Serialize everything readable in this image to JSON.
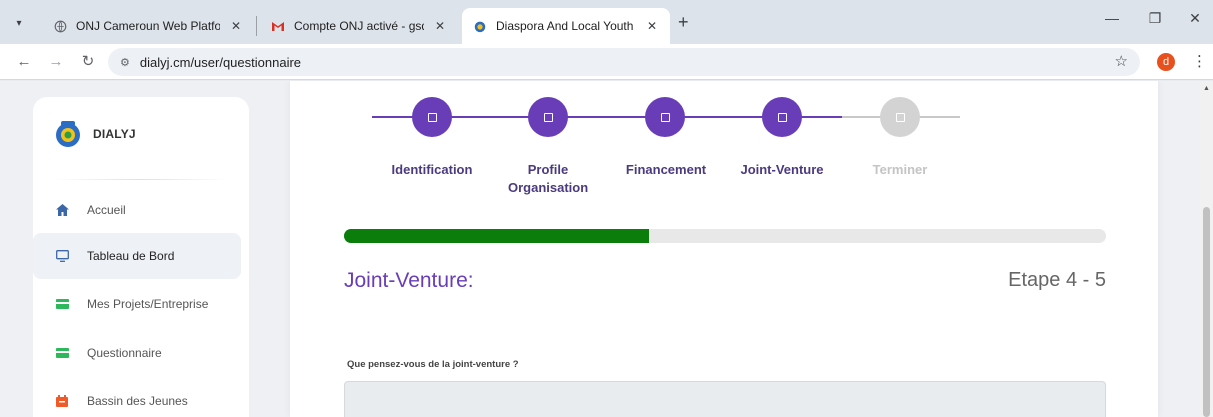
{
  "browser": {
    "tabs": [
      {
        "title": "ONJ Cameroun Web Platform",
        "active": false
      },
      {
        "title": "Compte ONJ activé - gsddialyj@",
        "active": false
      },
      {
        "title": "Diaspora And Local Youth Joint",
        "active": true
      }
    ],
    "url": "dialyj.cm/user/questionnaire",
    "profile_initial": "d"
  },
  "sidebar": {
    "brand": "DIALYJ",
    "items": [
      {
        "label": "Accueil",
        "icon": "home-icon"
      },
      {
        "label": "Tableau de Bord",
        "icon": "monitor-icon",
        "active": true
      },
      {
        "label": "Mes Projets/Entreprise",
        "icon": "card-icon"
      },
      {
        "label": "Questionnaire",
        "icon": "card-icon"
      },
      {
        "label": "Bassin des Jeunes",
        "icon": "calendar-icon"
      }
    ]
  },
  "stepper": {
    "steps": [
      {
        "label": "Identification",
        "done": true
      },
      {
        "label": "Profile Organisation",
        "done": true
      },
      {
        "label": "Financement",
        "done": true
      },
      {
        "label": "Joint-Venture",
        "done": true
      },
      {
        "label": "Terminer",
        "done": false
      }
    ],
    "progress_percent": 40
  },
  "section": {
    "title": "Joint-Venture:",
    "step_counter": "Etape 4 - 5"
  },
  "question": {
    "label": "Que pensez-vous de la joint-venture ?",
    "value": ""
  },
  "colors": {
    "accent": "#6a3db8",
    "progress": "#0b7d0b",
    "inactive": "#d3d3d3"
  }
}
